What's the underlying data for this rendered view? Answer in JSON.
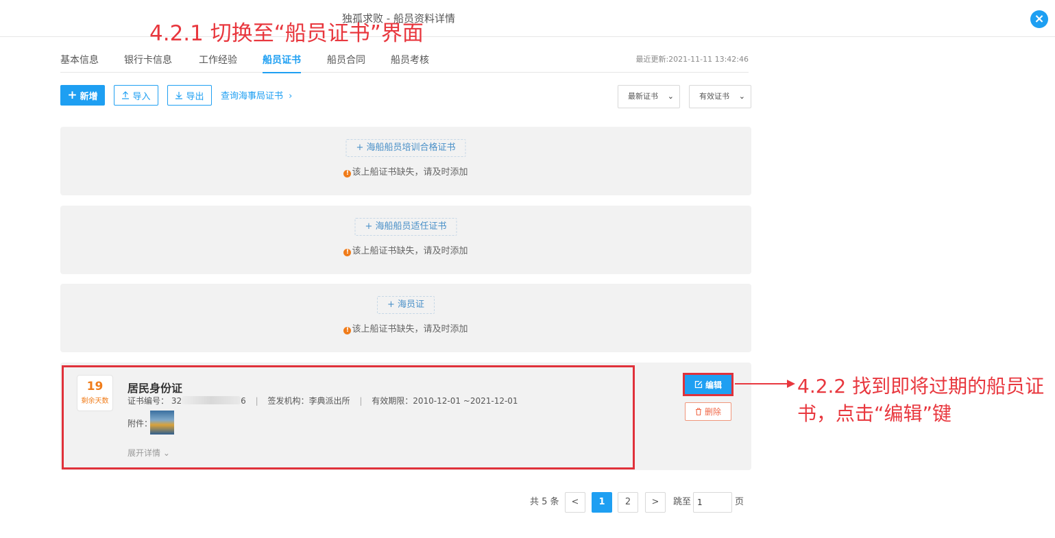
{
  "window": {
    "title": "独孤求败 - 船员资料详情",
    "close_icon": "×"
  },
  "annotations": {
    "step1": "4.2.1 切换至“船员证书”界面",
    "step2": "4.2.2 找到即将过期的船员证书，点击“编辑”键"
  },
  "tabs": [
    {
      "label": "基本信息"
    },
    {
      "label": "银行卡信息"
    },
    {
      "label": "工作经验"
    },
    {
      "label": "船员证书",
      "active": true
    },
    {
      "label": "船员合同"
    },
    {
      "label": "船员考核"
    }
  ],
  "last_update": "最近更新:2021-11-11 13:42:46",
  "toolbar": {
    "add_label": "新增",
    "import_label": "导入",
    "export_label": "导出",
    "query_link": "查询海事局证书",
    "filter_latest": "最新证书",
    "filter_valid": "有效证书"
  },
  "missing_certs": [
    {
      "button": "海船船员培训合格证书",
      "notice": "该上船证书缺失，请及时添加"
    },
    {
      "button": "海船船员适任证书",
      "notice": "该上船证书缺失，请及时添加"
    },
    {
      "button": "海员证",
      "notice": "该上船证书缺失，请及时添加"
    }
  ],
  "certificate": {
    "remaining_days": "19",
    "remaining_label": "剩余天数",
    "name": "居民身份证",
    "number_label": "证书编号：",
    "number_prefix": "32",
    "number_suffix": "6",
    "issuer_label": "签发机构：",
    "issuer": "李典派出所",
    "validity_label": "有效期限：",
    "validity": "2010-12-01 ~2021-12-01",
    "attachment_label": "附件：",
    "expand_label": "展开详情",
    "edit_label": "编辑",
    "delete_label": "删除"
  },
  "pagination": {
    "total_text": "共 5 条",
    "pages": [
      "1",
      "2"
    ],
    "current_page": "1",
    "jump_label": "跳至",
    "jump_value": "1",
    "page_unit": "页"
  },
  "colors": {
    "accent": "#1e9ff2",
    "annotation": "#e8373e",
    "warning": "#f07c1a"
  }
}
